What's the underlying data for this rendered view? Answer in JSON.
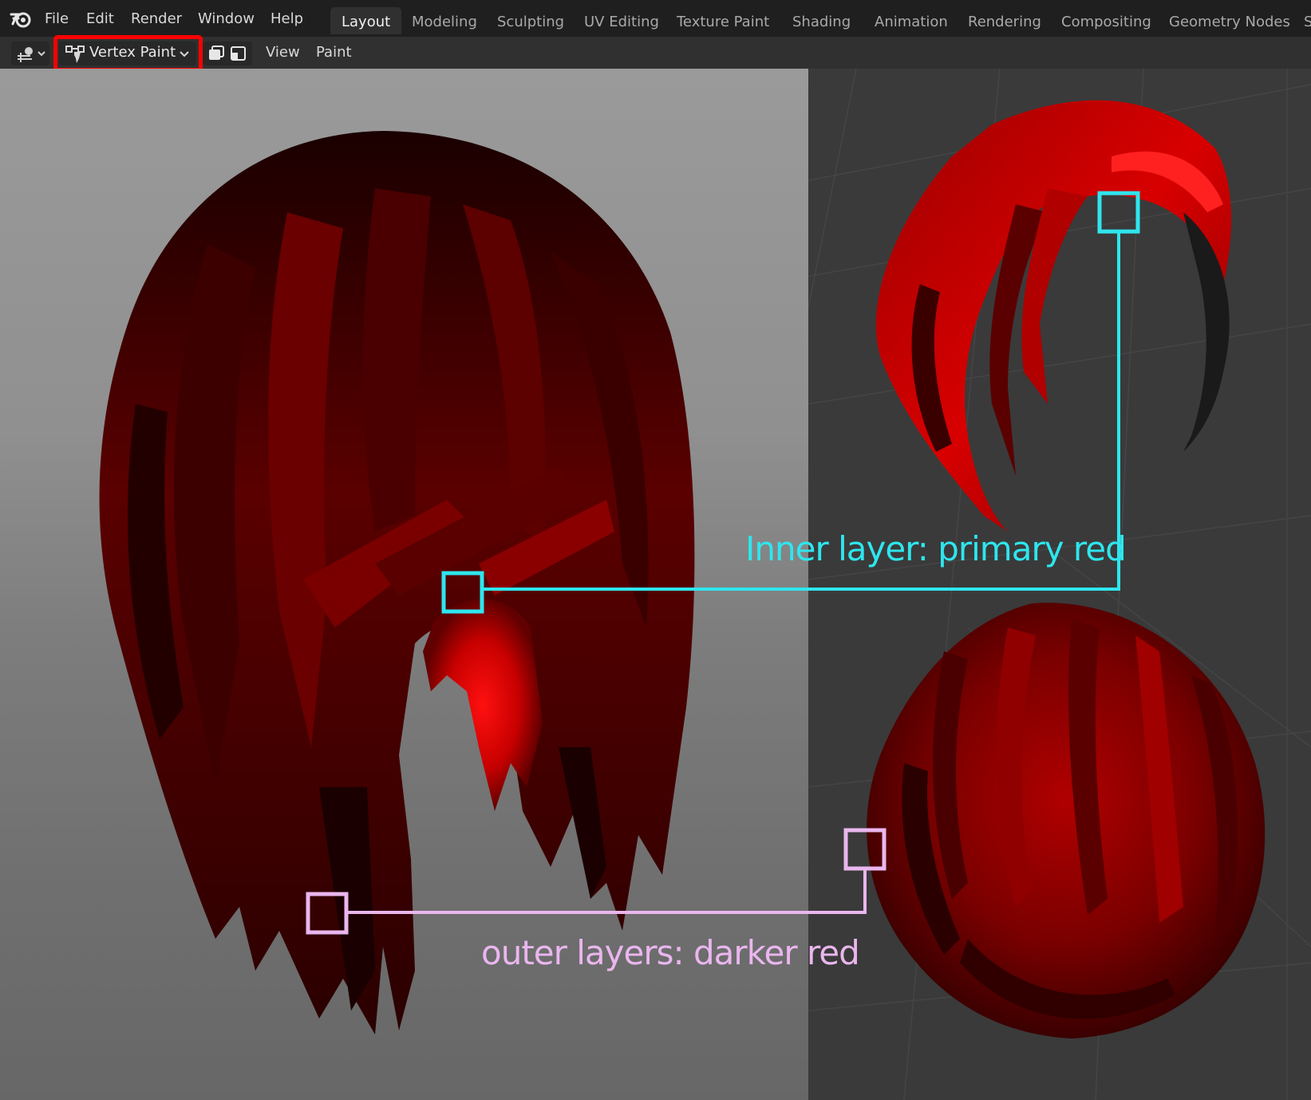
{
  "app": {
    "logo_icon": "blender-logo-icon"
  },
  "menu": {
    "items": [
      "File",
      "Edit",
      "Render",
      "Window",
      "Help"
    ]
  },
  "workspaces": {
    "tabs": [
      "Layout",
      "Modeling",
      "Sculpting",
      "UV Editing",
      "Texture Paint",
      "Shading",
      "Animation",
      "Rendering",
      "Compositing",
      "Geometry Nodes",
      "S"
    ],
    "active": "Layout"
  },
  "header": {
    "editor_type_icon": "view3d-icon",
    "mode": {
      "label": "Vertex Paint",
      "icon": "vertex-paint-icon",
      "highlight_color": "#ff0000"
    },
    "xray_icons": [
      "xray-toggle-icon",
      "overlay-toggle-icon"
    ],
    "menus": [
      "View",
      "Paint"
    ]
  },
  "annotations": {
    "inner": {
      "text": "Inner layer: primary red",
      "color": "#2ee6ee"
    },
    "outer": {
      "text": "outer layers: darker red",
      "color": "#eab6ee"
    }
  },
  "colors": {
    "primary_red": "#e00000",
    "darker_red": "#5a0000",
    "left_viewport_bg": "#909090",
    "right_viewport_bg": "#3a3a3a"
  }
}
